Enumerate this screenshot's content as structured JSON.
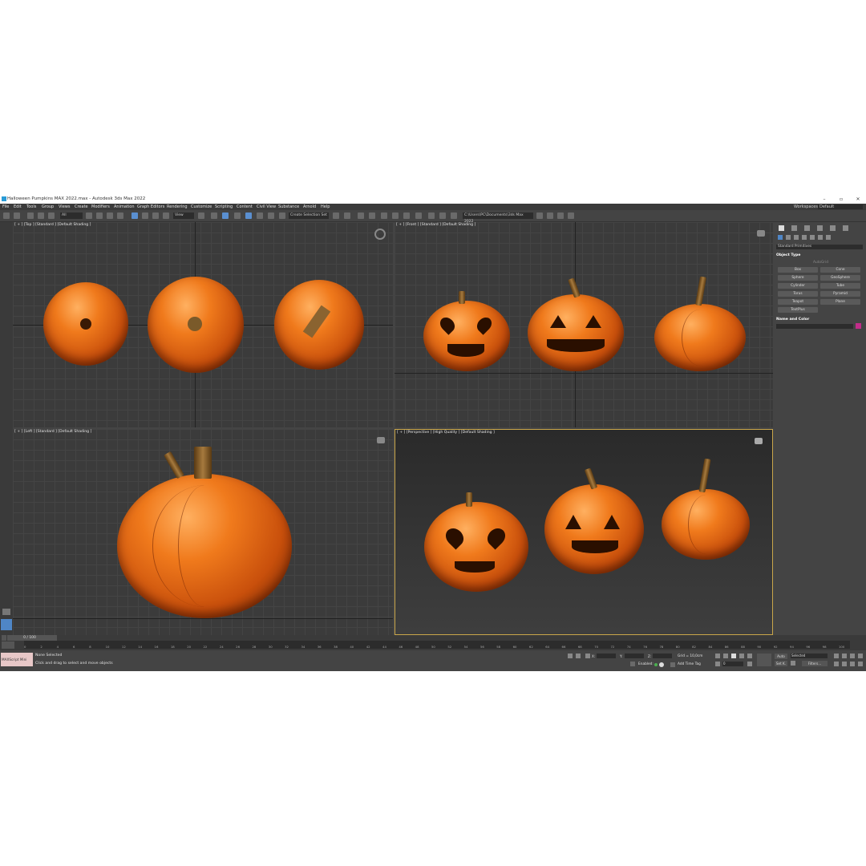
{
  "window": {
    "title": "Halloween Pumpkins MAX 2022.max - Autodesk 3ds Max 2022",
    "minimize": "–",
    "restore": "▫",
    "close": "✕"
  },
  "menu": [
    "File",
    "Edit",
    "Tools",
    "Group",
    "Views",
    "Create",
    "Modifiers",
    "Animation",
    "Graph Editors",
    "Rendering",
    "Customize",
    "Scripting",
    "Content",
    "Civil View",
    "Substance",
    "Arnold",
    "Help"
  ],
  "workspace": {
    "label": "Workspaces:",
    "value": "Default"
  },
  "toolbar": {
    "selection_filter": "All",
    "ref_coord": "View",
    "named_selection": "Create Selection Set",
    "project_path": "C:\\Users\\PC\\Documents\\3ds Max 2022"
  },
  "viewports": {
    "top": "[ + ] [Top ] [Standard ] [Default Shading ]",
    "front": "[ + ] [Front ] [Standard ] [Default Shading ]",
    "left": "[ + ] [Left ] [Standard ] [Default Shading ]",
    "perspective": "[ + ] [Perspective ] [High Quality ] [Default Shading ]"
  },
  "command_panel": {
    "category": "Standard Primitives",
    "object_type_header": "Object Type",
    "autogrid": "AutoGrid",
    "primitives": [
      "Box",
      "Cone",
      "Sphere",
      "GeoSphere",
      "Cylinder",
      "Tube",
      "Torus",
      "Pyramid",
      "Teapot",
      "Plane",
      "TextPlus"
    ],
    "name_color_header": "Name and Color",
    "swatch_color": "#c22c8a"
  },
  "timeline": {
    "slider": "0 / 100",
    "ticks": [
      "0",
      "2",
      "4",
      "6",
      "8",
      "10",
      "12",
      "14",
      "16",
      "18",
      "20",
      "22",
      "24",
      "26",
      "28",
      "30",
      "32",
      "34",
      "36",
      "38",
      "40",
      "42",
      "44",
      "46",
      "48",
      "50",
      "52",
      "54",
      "56",
      "58",
      "60",
      "62",
      "64",
      "66",
      "68",
      "70",
      "72",
      "74",
      "76",
      "78",
      "80",
      "82",
      "84",
      "86",
      "88",
      "90",
      "92",
      "94",
      "96",
      "98",
      "100"
    ]
  },
  "status": {
    "maxscript": "MAXScript Mini",
    "selection": "None Selected",
    "prompt": "Click and drag to select and move objects",
    "x_label": "X:",
    "y_label": "Y:",
    "z_label": "Z:",
    "grid": "Grid = 10,0cm",
    "enabled": "Enabled:",
    "add_time_tag": "Add Time Tag",
    "frame": "0",
    "auto": "Auto",
    "set_k": "Set K.",
    "key_filter": "Selected",
    "filters": "Filters..."
  }
}
